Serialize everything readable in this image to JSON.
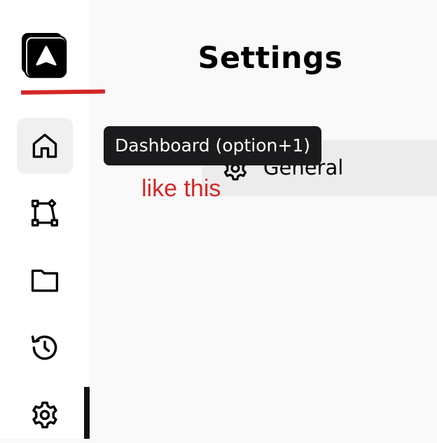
{
  "page": {
    "title": "Settings"
  },
  "sidebar": {
    "logo_icon": "app-logo-icon",
    "items": [
      {
        "id": "dashboard",
        "icon": "home-icon",
        "active": true
      },
      {
        "id": "flows",
        "icon": "workflow-icon",
        "active": false
      },
      {
        "id": "files",
        "icon": "folder-icon",
        "active": false
      },
      {
        "id": "history",
        "icon": "history-icon",
        "active": false
      },
      {
        "id": "settings",
        "icon": "gear-icon",
        "active": false
      }
    ]
  },
  "tooltip": {
    "text": "Dashboard (option+1)"
  },
  "settings_menu": {
    "items": [
      {
        "label": "General",
        "icon": "gear-icon",
        "selected": true
      }
    ]
  },
  "annotation": {
    "text": "like this",
    "color": "#d42727"
  },
  "colors": {
    "accent_red": "#d42727",
    "tooltip_bg": "#1b1b1d",
    "active_bg": "#f0f0f0",
    "selected_row_bg": "#ececec"
  }
}
